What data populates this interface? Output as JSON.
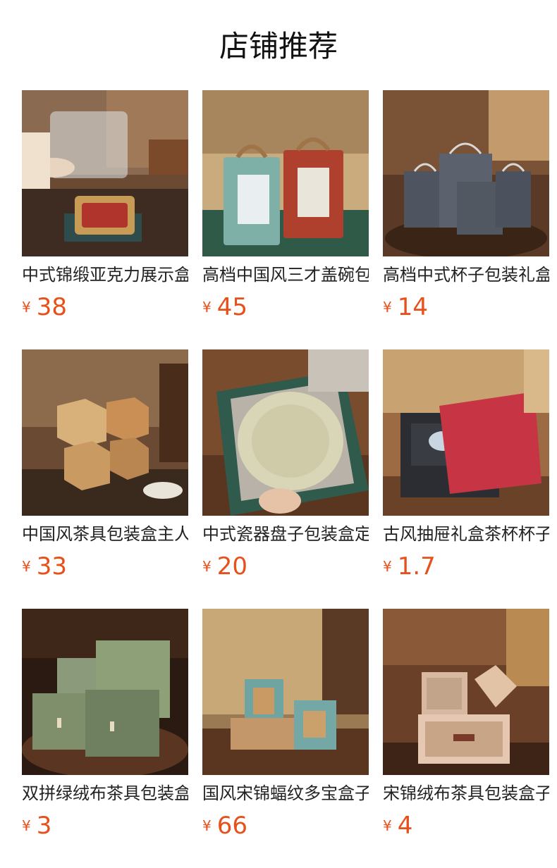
{
  "page": {
    "title": "店铺推荐"
  },
  "currency_symbol": "¥",
  "colors": {
    "price": "#e8501b",
    "text": "#222222"
  },
  "products": [
    {
      "name": "中式锦缎亚克力展示盒",
      "price": "38",
      "image": "acrylic-display-box-photo"
    },
    {
      "name": "高档中国风三才盖碗包装盒",
      "price": "45",
      "image": "gaiwan-gift-box-photo"
    },
    {
      "name": "高档中式杯子包装礼盒",
      "price": "14",
      "image": "cup-gift-bag-photo"
    },
    {
      "name": "中国风茶具包装盒主人杯",
      "price": "33",
      "image": "hexagon-tea-box-photo"
    },
    {
      "name": "中式瓷器盘子包装盒定制",
      "price": "20",
      "image": "porcelain-plate-box-photo"
    },
    {
      "name": "古风抽屉礼盒茶杯杯子",
      "price": "1.7",
      "image": "drawer-gift-box-photo"
    },
    {
      "name": "双拼绿绒布茶具包装盒",
      "price": "3",
      "image": "green-velvet-box-photo"
    },
    {
      "name": "国风宋锦蝠纹多宝盒子",
      "price": "66",
      "image": "song-brocade-multi-box-photo"
    },
    {
      "name": "宋锦绒布茶具包装盒子",
      "price": "4",
      "image": "song-brocade-velvet-box-photo"
    }
  ]
}
